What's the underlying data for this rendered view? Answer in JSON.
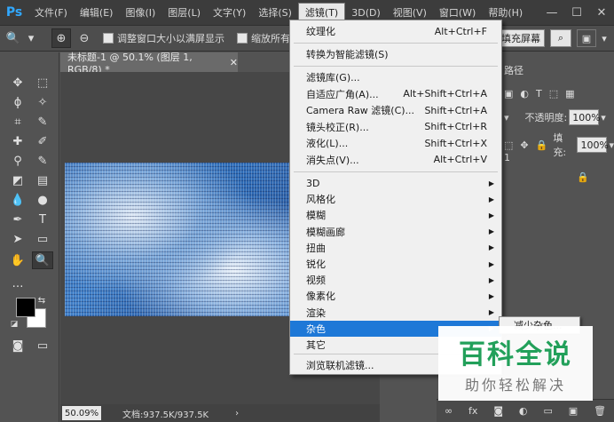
{
  "app": {
    "logo": "Ps"
  },
  "menubar": {
    "items": [
      "文件(F)",
      "编辑(E)",
      "图像(I)",
      "图层(L)",
      "文字(Y)",
      "选择(S)",
      "滤镜(T)",
      "3D(D)",
      "视图(V)",
      "窗口(W)",
      "帮助(H)"
    ],
    "active_index": 6
  },
  "options": {
    "resize_label": "调整窗口大小以满屏显示",
    "zoom_all_label": "缩放所有",
    "fill_screen_label": "填充屏幕"
  },
  "document": {
    "tab_title": "未标题-1 @ 50.1% (图层 1, RGB/8) *",
    "zoom": "50.09%",
    "doc_info": "文档:937.5K/937.5K"
  },
  "panels": {
    "tab_fragment": "路径",
    "opacity_label": "不透明度:",
    "opacity_value": "100%",
    "fill_label": "填充:",
    "fill_value": "100%",
    "layer_fragment": "1"
  },
  "filter_menu": {
    "last_filter": {
      "label": "纹理化",
      "shortcut": "Alt+Ctrl+F"
    },
    "smart": {
      "label": "转换为智能滤镜(S)"
    },
    "group1": [
      {
        "label": "滤镜库(G)...",
        "shortcut": ""
      },
      {
        "label": "自适应广角(A)...",
        "shortcut": "Alt+Shift+Ctrl+A"
      },
      {
        "label": "Camera Raw 滤镜(C)...",
        "shortcut": "Shift+Ctrl+A"
      },
      {
        "label": "镜头校正(R)...",
        "shortcut": "Shift+Ctrl+R"
      },
      {
        "label": "液化(L)...",
        "shortcut": "Shift+Ctrl+X"
      },
      {
        "label": "消失点(V)...",
        "shortcut": "Alt+Ctrl+V"
      }
    ],
    "group2": [
      "3D",
      "风格化",
      "模糊",
      "模糊画廊",
      "扭曲",
      "锐化",
      "视频",
      "像素化",
      "渲染",
      "杂色",
      "其它"
    ],
    "highlighted": "杂色",
    "browse": "浏览联机滤镜..."
  },
  "submenu": {
    "first_item": "减少杂色..."
  },
  "watermark": {
    "main": "百科全说",
    "sub": "助你轻松解决"
  }
}
